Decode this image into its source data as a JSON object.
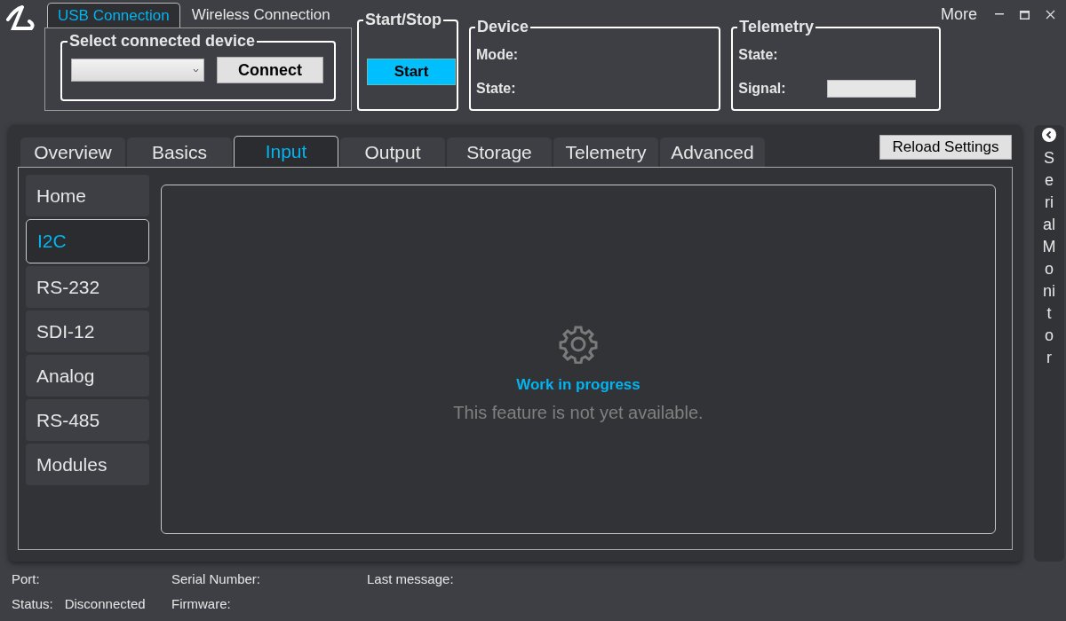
{
  "connection_tabs": [
    {
      "label": "USB Connection",
      "selected": true
    },
    {
      "label": "Wireless Connection",
      "selected": false
    }
  ],
  "device_select": {
    "title": "Select connected device",
    "connect_button": "Connect"
  },
  "start_stop": {
    "title": "Start/Stop",
    "button": "Start"
  },
  "device": {
    "title": "Device",
    "fields": [
      "Mode:",
      "State:"
    ]
  },
  "telemetry": {
    "title": "Telemetry",
    "state_label": "State:",
    "signal_label": "Signal:",
    "signal": {
      "level": 0
    }
  },
  "window": {
    "more": "More"
  },
  "tabs": [
    {
      "label": "Overview",
      "selected": false
    },
    {
      "label": "Basics",
      "selected": false
    },
    {
      "label": "Input",
      "selected": true
    },
    {
      "label": "Output",
      "selected": false
    },
    {
      "label": "Storage",
      "selected": false
    },
    {
      "label": "Telemetry",
      "selected": false
    },
    {
      "label": "Advanced",
      "selected": false
    }
  ],
  "reload_button": "Reload Settings",
  "sidebar": {
    "items": [
      {
        "label": "Home",
        "selected": false
      },
      {
        "label": "I2C",
        "selected": true
      },
      {
        "label": "RS-232",
        "selected": false
      },
      {
        "label": "SDI-12",
        "selected": false
      },
      {
        "label": "Analog",
        "selected": false
      },
      {
        "label": "RS-485",
        "selected": false
      },
      {
        "label": "Modules",
        "selected": false
      }
    ]
  },
  "content": {
    "title": "Work in progress",
    "message": "This feature is not yet available."
  },
  "serial_monitor": {
    "label": "Serial Monitor"
  },
  "status_bar": {
    "port": "Port:",
    "status_label": "Status:",
    "status_value": "Disconnected",
    "serial_number": "Serial Number:",
    "firmware": "Firmware:",
    "last_message": "Last message:"
  }
}
